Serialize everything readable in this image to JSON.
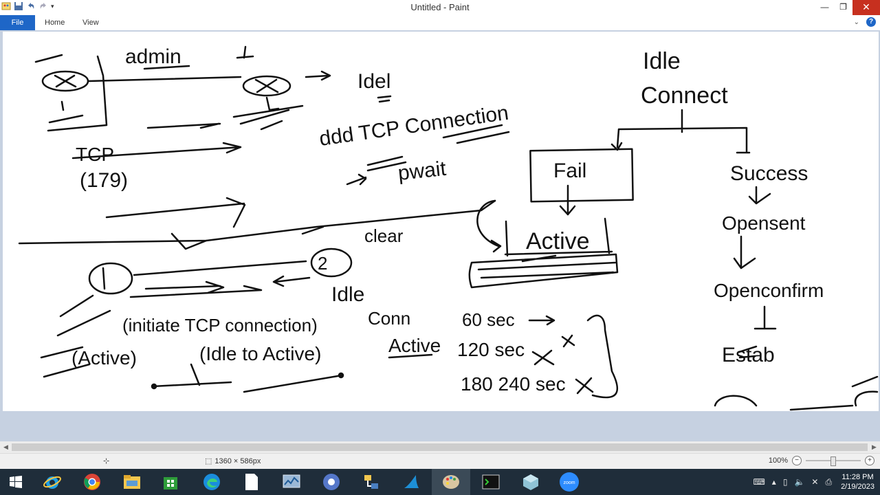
{
  "window": {
    "title": "Untitled - Paint"
  },
  "ribbon": {
    "tabs": [
      "File",
      "Home",
      "View"
    ]
  },
  "canvas": {
    "labels": [
      "admin",
      "Idel",
      "ddd TCP Connection",
      "pwait",
      "Idle",
      "Connect",
      "Fail",
      "Success",
      "Active",
      "Opensent",
      "Openconfirm",
      "TCP",
      "(179)",
      "clear",
      "Idle",
      "(initiate TCP connection)",
      "Conn",
      "60 sec",
      "(Active)",
      "(Idle to Active)",
      "Active",
      "120 sec",
      "180 240 sec",
      "Estab"
    ]
  },
  "statusbar": {
    "dimensions": "1360 × 586px",
    "zoom": "100%"
  },
  "taskbar": {
    "apps": [
      "start-button",
      "internet-explorer",
      "chrome",
      "file-explorer",
      "store",
      "edge",
      "notepad",
      "task-manager",
      "app-blue-circle",
      "network-app",
      "shark-app",
      "paint",
      "terminal",
      "app-box",
      "zoom"
    ],
    "time": "11:28 PM",
    "date": "2/19/2023"
  }
}
